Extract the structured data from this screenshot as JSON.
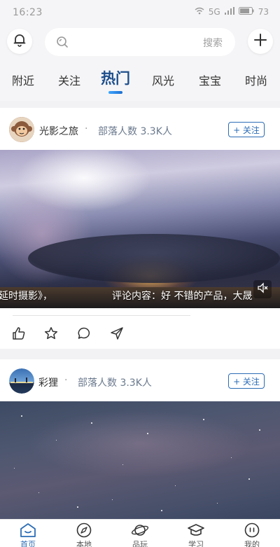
{
  "status_bar": {
    "time": "16:23",
    "signal_text": "5G",
    "battery": "73"
  },
  "header": {
    "search_button": "搜索"
  },
  "tabs": [
    {
      "label": "附近"
    },
    {
      "label": "关注"
    },
    {
      "label": "热门"
    },
    {
      "label": "风光"
    },
    {
      "label": "宝宝"
    },
    {
      "label": "时尚"
    }
  ],
  "posts": [
    {
      "author": "光影之旅",
      "separator": "·",
      "members_label": "部落人数",
      "members_count": "3.3K人",
      "follow_label": "+ 关注",
      "danmaku_left": "延时摄影》，",
      "danmaku_right": "评论内容：好 不错的产品，大晟"
    },
    {
      "author": "彩狸",
      "separator": "·",
      "members_label": "部落人数",
      "members_count": "3.3K人",
      "follow_label": "+ 关注"
    }
  ],
  "bottom_nav": [
    {
      "label": "首页",
      "icon": "home-icon",
      "active": true
    },
    {
      "label": "本地",
      "icon": "compass-icon",
      "active": false
    },
    {
      "label": "品玩",
      "icon": "planet-icon",
      "active": false
    },
    {
      "label": "学习",
      "icon": "graduation-cap-icon",
      "active": false
    },
    {
      "label": "我的",
      "icon": "profile-icon",
      "active": false
    }
  ],
  "colors": {
    "accent": "#2b6cb5",
    "active_tab": "#1d4f8c",
    "background": "#f2f2f4"
  }
}
